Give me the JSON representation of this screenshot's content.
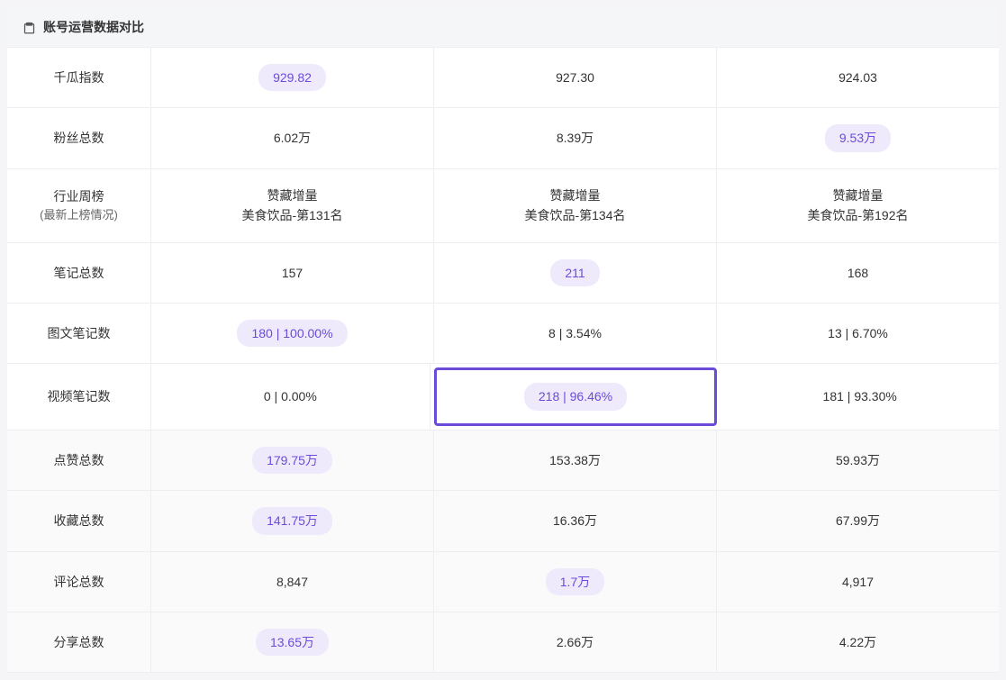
{
  "header": {
    "title": "账号运营数据对比"
  },
  "rows": [
    {
      "label": "千瓜指数",
      "labelSub": "",
      "dim": false,
      "cells": [
        {
          "value": "929.82",
          "pill": true,
          "highlighted": false,
          "sub": ""
        },
        {
          "value": "927.30",
          "pill": false,
          "highlighted": false,
          "sub": ""
        },
        {
          "value": "924.03",
          "pill": false,
          "highlighted": false,
          "sub": ""
        }
      ]
    },
    {
      "label": "粉丝总数",
      "labelSub": "",
      "dim": false,
      "cells": [
        {
          "value": "6.02万",
          "pill": false,
          "highlighted": false,
          "sub": ""
        },
        {
          "value": "8.39万",
          "pill": false,
          "highlighted": false,
          "sub": ""
        },
        {
          "value": "9.53万",
          "pill": true,
          "highlighted": false,
          "sub": ""
        }
      ]
    },
    {
      "label": "行业周榜",
      "labelSub": "(最新上榜情况)",
      "dim": false,
      "cells": [
        {
          "value": "赞藏增量",
          "pill": false,
          "highlighted": false,
          "sub": "美食饮品-第131名"
        },
        {
          "value": "赞藏增量",
          "pill": false,
          "highlighted": false,
          "sub": "美食饮品-第134名"
        },
        {
          "value": "赞藏增量",
          "pill": false,
          "highlighted": false,
          "sub": "美食饮品-第192名"
        }
      ]
    },
    {
      "label": "笔记总数",
      "labelSub": "",
      "dim": false,
      "cells": [
        {
          "value": "157",
          "pill": false,
          "highlighted": false,
          "sub": ""
        },
        {
          "value": "211",
          "pill": true,
          "highlighted": false,
          "sub": ""
        },
        {
          "value": "168",
          "pill": false,
          "highlighted": false,
          "sub": ""
        }
      ]
    },
    {
      "label": "图文笔记数",
      "labelSub": "",
      "dim": false,
      "cells": [
        {
          "value": "180 | 100.00%",
          "pill": true,
          "highlighted": false,
          "sub": ""
        },
        {
          "value": "8 | 3.54%",
          "pill": false,
          "highlighted": false,
          "sub": ""
        },
        {
          "value": "13 | 6.70%",
          "pill": false,
          "highlighted": false,
          "sub": ""
        }
      ]
    },
    {
      "label": "视频笔记数",
      "labelSub": "",
      "dim": false,
      "cells": [
        {
          "value": "0 | 0.00%",
          "pill": false,
          "highlighted": false,
          "sub": ""
        },
        {
          "value": "218 | 96.46%",
          "pill": true,
          "highlighted": true,
          "sub": ""
        },
        {
          "value": "181 | 93.30%",
          "pill": false,
          "highlighted": false,
          "sub": ""
        }
      ]
    },
    {
      "label": "点赞总数",
      "labelSub": "",
      "dim": true,
      "cells": [
        {
          "value": "179.75万",
          "pill": true,
          "highlighted": false,
          "sub": ""
        },
        {
          "value": "153.38万",
          "pill": false,
          "highlighted": false,
          "sub": ""
        },
        {
          "value": "59.93万",
          "pill": false,
          "highlighted": false,
          "sub": ""
        }
      ]
    },
    {
      "label": "收藏总数",
      "labelSub": "",
      "dim": true,
      "cells": [
        {
          "value": "141.75万",
          "pill": true,
          "highlighted": false,
          "sub": ""
        },
        {
          "value": "16.36万",
          "pill": false,
          "highlighted": false,
          "sub": ""
        },
        {
          "value": "67.99万",
          "pill": false,
          "highlighted": false,
          "sub": ""
        }
      ]
    },
    {
      "label": "评论总数",
      "labelSub": "",
      "dim": true,
      "cells": [
        {
          "value": "8,847",
          "pill": false,
          "highlighted": false,
          "sub": ""
        },
        {
          "value": "1.7万",
          "pill": true,
          "highlighted": false,
          "sub": ""
        },
        {
          "value": "4,917",
          "pill": false,
          "highlighted": false,
          "sub": ""
        }
      ]
    },
    {
      "label": "分享总数",
      "labelSub": "",
      "dim": true,
      "cells": [
        {
          "value": "13.65万",
          "pill": true,
          "highlighted": false,
          "sub": ""
        },
        {
          "value": "2.66万",
          "pill": false,
          "highlighted": false,
          "sub": ""
        },
        {
          "value": "4.22万",
          "pill": false,
          "highlighted": false,
          "sub": ""
        }
      ]
    }
  ]
}
